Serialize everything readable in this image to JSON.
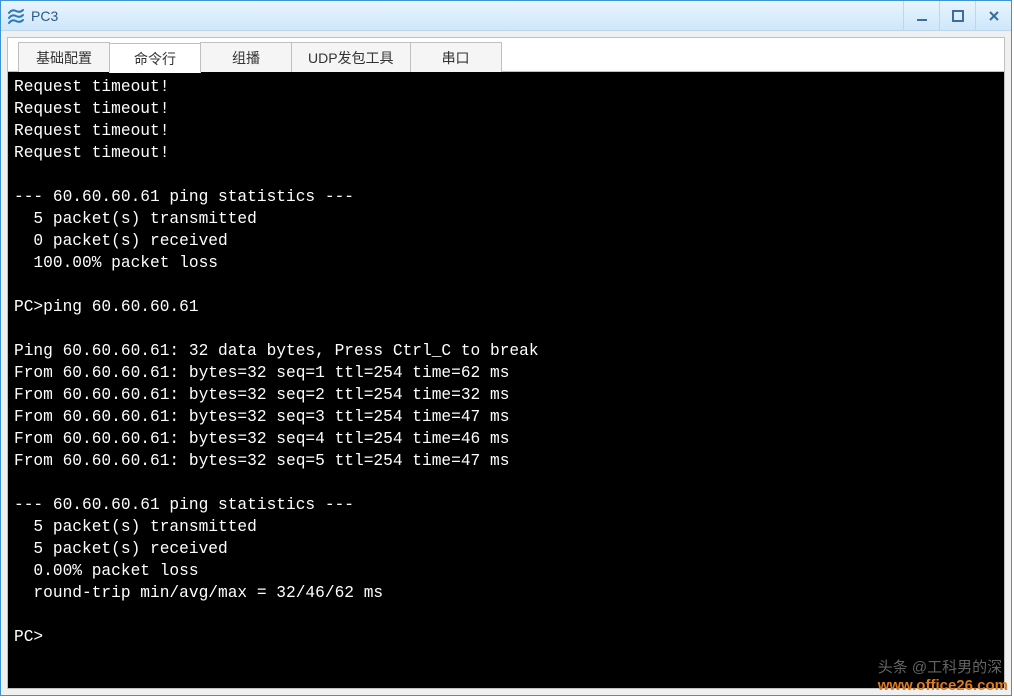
{
  "window": {
    "title": "PC3"
  },
  "tabs": [
    {
      "label": "基础配置",
      "active": false
    },
    {
      "label": "命令行",
      "active": true
    },
    {
      "label": "组播",
      "active": false
    },
    {
      "label": "UDP发包工具",
      "active": false
    },
    {
      "label": "串口",
      "active": false
    }
  ],
  "terminal": {
    "lines": [
      "Request timeout!",
      "Request timeout!",
      "Request timeout!",
      "Request timeout!",
      "",
      "--- 60.60.60.61 ping statistics ---",
      "  5 packet(s) transmitted",
      "  0 packet(s) received",
      "  100.00% packet loss",
      "",
      "PC>ping 60.60.60.61",
      "",
      "Ping 60.60.60.61: 32 data bytes, Press Ctrl_C to break",
      "From 60.60.60.61: bytes=32 seq=1 ttl=254 time=62 ms",
      "From 60.60.60.61: bytes=32 seq=2 ttl=254 time=32 ms",
      "From 60.60.60.61: bytes=32 seq=3 ttl=254 time=47 ms",
      "From 60.60.60.61: bytes=32 seq=4 ttl=254 time=46 ms",
      "From 60.60.60.61: bytes=32 seq=5 ttl=254 time=47 ms",
      "",
      "--- 60.60.60.61 ping statistics ---",
      "  5 packet(s) transmitted",
      "  5 packet(s) received",
      "  0.00% packet loss",
      "  round-trip min/avg/max = 32/46/62 ms",
      "",
      "PC>"
    ]
  },
  "watermark": {
    "text1": "头条 @工科男的深",
    "text2": "www.office26.com"
  }
}
